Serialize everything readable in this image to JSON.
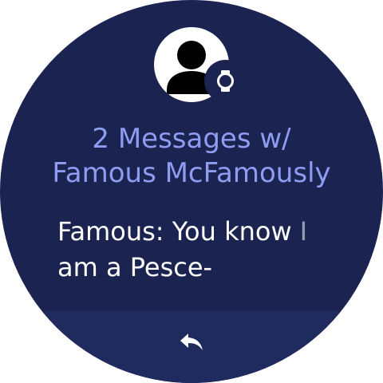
{
  "notification": {
    "title_line1": "2 Messages w/",
    "title_line2": "Famous McFamously",
    "message_line1": "Famous: You know I",
    "message_line2": "am a Pesce-"
  },
  "icons": {
    "avatar": "person-avatar-icon",
    "app_badge": "watch-icon",
    "reply": "reply-arrow-icon"
  },
  "colors": {
    "background": "#1b2451",
    "action_bar": "#1f2a5e",
    "title": "#8e9cf2",
    "message": "#ffffff"
  }
}
